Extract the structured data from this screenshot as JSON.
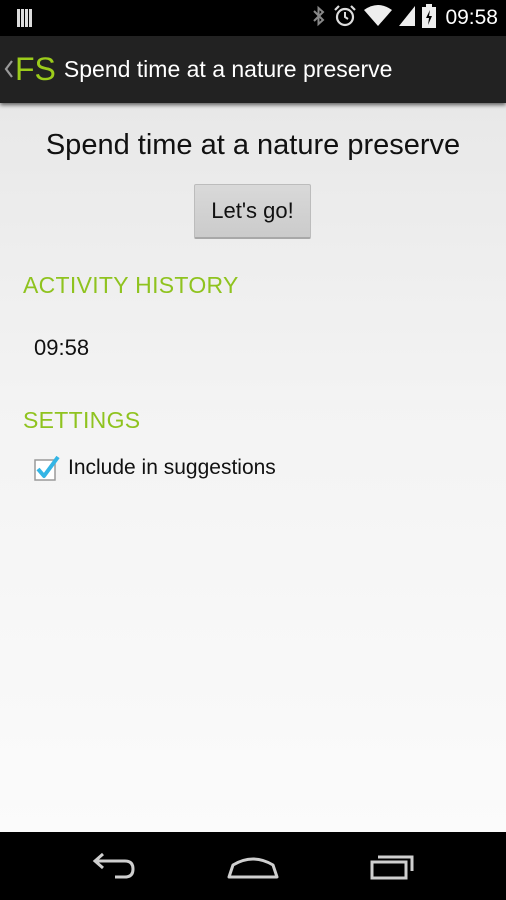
{
  "status_bar": {
    "time": "09:58",
    "icons": [
      "notification-icon",
      "bluetooth-icon",
      "alarm-icon",
      "wifi-icon",
      "signal-icon",
      "battery-icon"
    ]
  },
  "action_bar": {
    "up_icon": "chevron-left-icon",
    "logo": "FS",
    "title": "Spend time at a nature preserve"
  },
  "main": {
    "activity_title": "Spend time at a nature preserve",
    "go_button_label": "Let's go!",
    "history_header": "ACTIVITY HISTORY",
    "history": [
      {
        "time": "09:58"
      }
    ],
    "settings_header": "SETTINGS",
    "settings": {
      "include_label": "Include in suggestions",
      "include_checked": true
    }
  },
  "nav_bar": {
    "icons": [
      "back-icon",
      "home-icon",
      "recent-apps-icon"
    ]
  },
  "colors": {
    "accent": "#8fc31f",
    "logo": "#9ccc1b",
    "action_bar": "#222222",
    "checkmark": "#33b5e5"
  }
}
